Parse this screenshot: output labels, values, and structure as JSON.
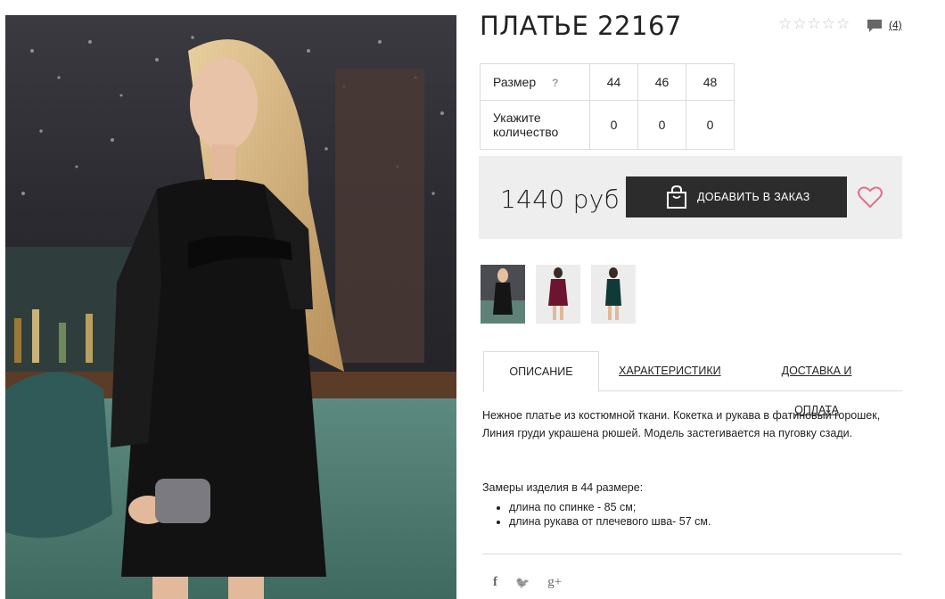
{
  "product": {
    "title": "ПЛАТЬЕ 22167",
    "reviews_count": "(4)",
    "rating_stars": [
      "☆",
      "☆",
      "☆",
      "☆",
      "☆"
    ]
  },
  "sizes": {
    "size_label": "Размер",
    "help": "?",
    "values": [
      "44",
      "46",
      "48"
    ],
    "qty_label": "Укажите количество",
    "quantities": [
      "0",
      "0",
      "0"
    ]
  },
  "buy": {
    "price": "1440 руб",
    "add_button": "ДОБАВИТЬ В ЗАКАЗ"
  },
  "tabs": {
    "description": "ОПИСАНИЕ",
    "specs": "ХАРАКТЕРИСТИКИ",
    "delivery": "ДОСТАВКА И ОПЛАТА"
  },
  "description": {
    "text": "Нежное платье из костюмной ткани. Кокетка и рукава в фатиновый горошек, Линия груди украшена рюшей. Модель застегивается на пуговку сзади.",
    "measure_title": "Замеры изделия в 44 размере:",
    "measures": [
      "длина по спинке - 85 см;",
      "длина рукава от плечевого шва- 57 см."
    ]
  },
  "social": {
    "facebook": "f",
    "twitter": "🐦",
    "googleplus": "g+"
  },
  "icons": {
    "comment": "comment-icon",
    "bag": "shopping-bag-icon",
    "heart": "heart-icon"
  },
  "colors": {
    "button_bg": "#2c2c2c",
    "buybox_bg": "#eeeeef",
    "heart": "#e0708a"
  }
}
